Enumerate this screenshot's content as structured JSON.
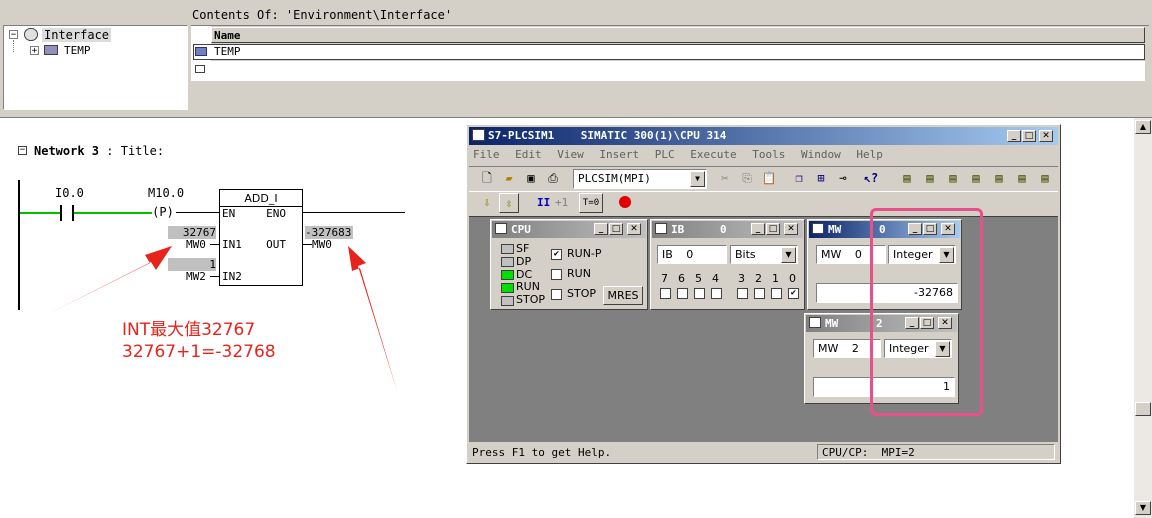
{
  "tree": {
    "root": "Interface",
    "child": "TEMP"
  },
  "details": {
    "contents": "Contents Of: 'Environment\\Interface'",
    "col_name": "Name",
    "row1": "TEMP"
  },
  "network": {
    "title_prefix": "Network 3",
    "title_sep": ":",
    "title": "Title:",
    "contact1": "I0.0",
    "contact2": "M10.0",
    "coil_p": "P",
    "block": "ADD_I",
    "en": "EN",
    "eno": "ENO",
    "in1": "IN1",
    "in2": "IN2",
    "out": "OUT",
    "in1_value": "32767",
    "in1_addr": "MW0",
    "in2_value": "1",
    "in2_addr": "MW2",
    "out_value": "-327683",
    "out_addr": "MW0"
  },
  "annotation": {
    "line1": "INT最大值32767",
    "line2": "32767+1=-32768",
    "color": "#e8231b"
  },
  "plcsim": {
    "title": "S7-PLCSIM1    SIMATIC 300(1)\\CPU 314",
    "menu": [
      "File",
      "Edit",
      "View",
      "Insert",
      "PLC",
      "Execute",
      "Tools",
      "Window",
      "Help"
    ],
    "interface": "PLCSIM(MPI)",
    "toolbar2_label": "+1",
    "toolbar2_t0": "T=0",
    "status_left": "Press F1 to get Help.",
    "status_right": "CPU/CP:  MPI=2",
    "cpu": {
      "title": "CPU",
      "leds": [
        "SF",
        "DP",
        "DC",
        "RUN",
        "STOP"
      ],
      "runp": "RUN-P",
      "run": "RUN",
      "stop": "STOP",
      "mres": "MRES"
    },
    "ib": {
      "title": "IB",
      "num": "0",
      "addr_label": "IB",
      "addr_num": "0",
      "format": "Bits",
      "bits": [
        "7",
        "6",
        "5",
        "4",
        "3",
        "2",
        "1",
        "0"
      ]
    },
    "mw0": {
      "title": "MW",
      "num": "0",
      "addr_label": "MW",
      "addr_num": "0",
      "format": "Integer",
      "value": "-32768"
    },
    "mw2": {
      "title": "MW",
      "num": "2",
      "addr_label": "MW",
      "addr_num": "2",
      "format": "Integer",
      "value": "1"
    }
  }
}
